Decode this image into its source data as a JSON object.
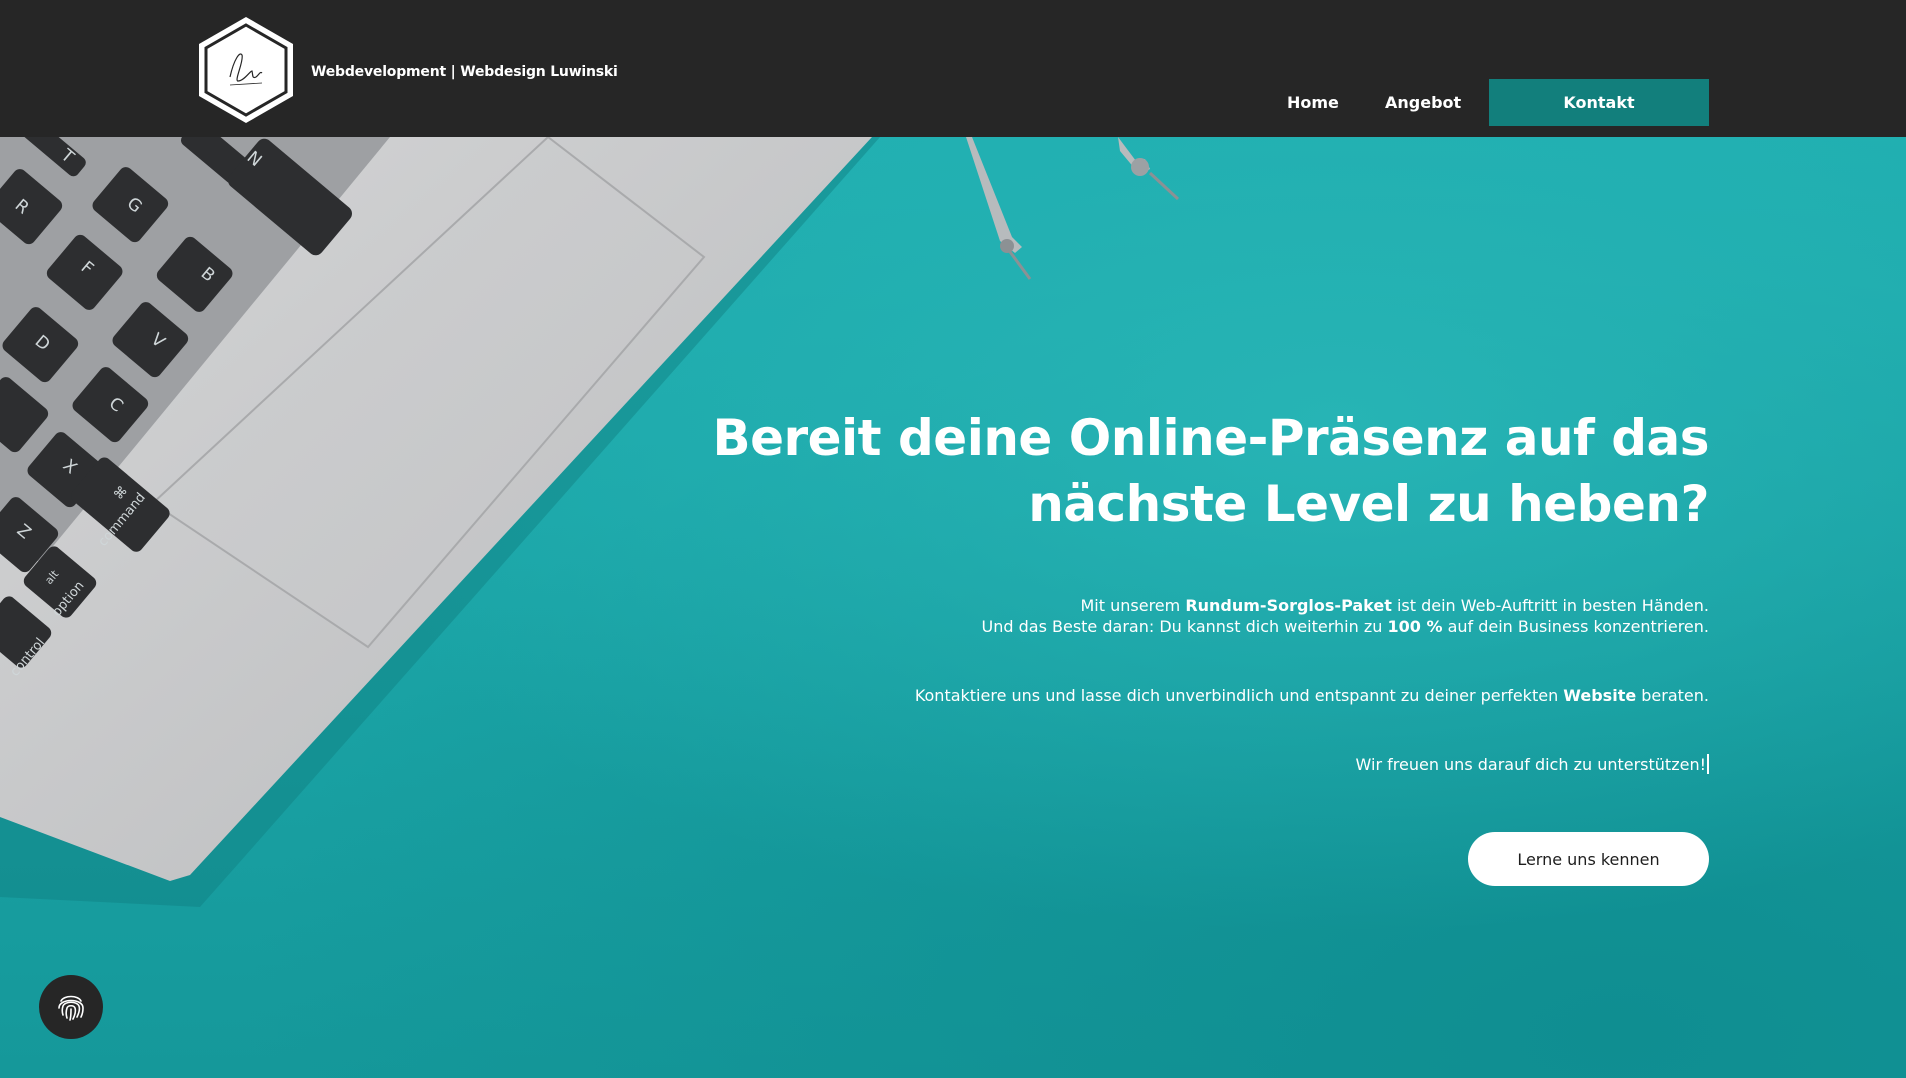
{
  "header": {
    "brand": "Webdevelopment | Webdesign Luwinski",
    "logo_text": "Lu",
    "nav": {
      "home": "Home",
      "angebot": "Angebot",
      "kontakt": "Kontakt"
    }
  },
  "hero": {
    "headline_line1": "Bereit deine Online-Präsenz auf das",
    "headline_line2": "nächste Level zu heben?",
    "p1_a": "Mit unserem ",
    "p1_b": "Rundum-Sorglos-Paket",
    "p1_c": " ist dein Web-Auftritt in besten Händen.",
    "p1_d": "Und das Beste daran: Du kannst dich weiterhin zu ",
    "p1_e": "100 %",
    "p1_f": " auf dein Business konzentrieren.",
    "p2_a": "Kontaktiere uns und lasse dich unverbindlich und entspannt zu deiner perfekten ",
    "p2_b": "Website",
    "p2_c": " beraten.",
    "p3": "Wir freuen uns darauf dich zu unterstützen!",
    "cta_label": "Lerne uns kennen"
  },
  "keyboard_keys": [
    "T",
    "N",
    "R",
    "G",
    "B",
    "F",
    "V",
    "D",
    "C",
    "X",
    "Z",
    "⌘",
    "command",
    "alt",
    "option",
    "control"
  ],
  "icons": {
    "fingerprint": "fingerprint-icon",
    "logo": "hexagon-logo-icon"
  },
  "colors": {
    "header_bg": "#262626",
    "accent": "#127f7c",
    "hero_bg": "#1aa3a5",
    "text": "#ffffff"
  }
}
